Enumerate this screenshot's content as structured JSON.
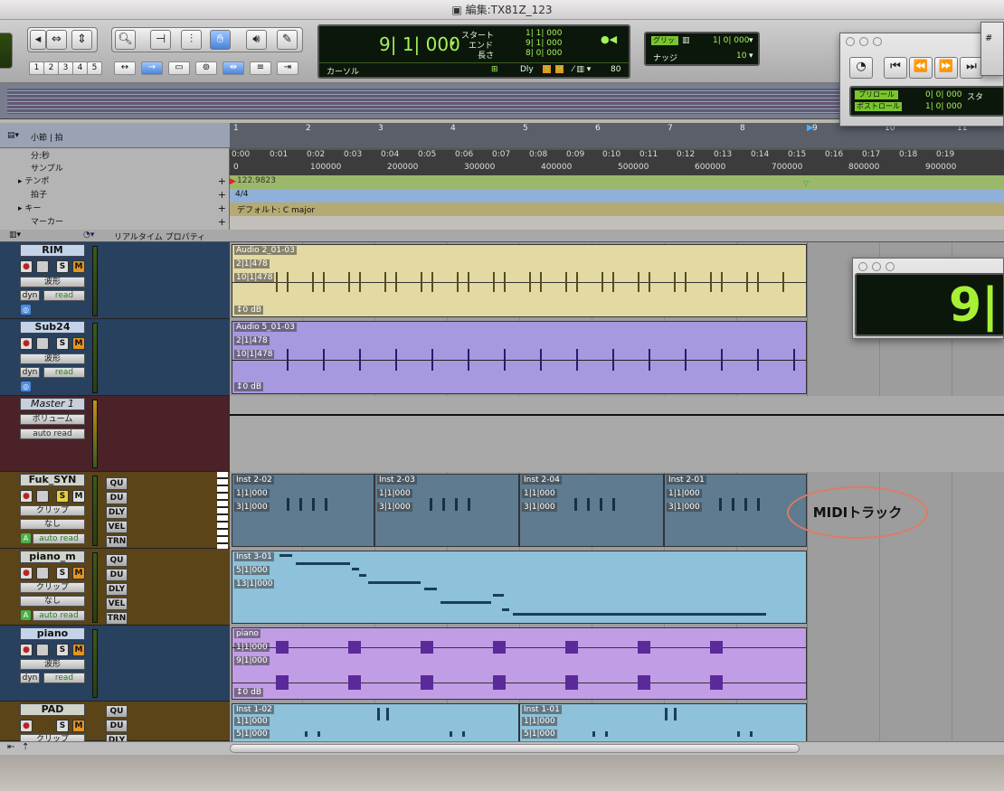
{
  "window": {
    "title": "編集:TX81Z_123"
  },
  "toolbar": {
    "zoom_presets": [
      "1",
      "2",
      "3",
      "4",
      "5"
    ],
    "counter": {
      "main": "9| 1| 000",
      "start_label": "スタート",
      "end_label": "エンド",
      "length_label": "長さ",
      "start": "1| 1| 000",
      "end": "9| 1| 000",
      "length": "8| 0| 000",
      "cursor_label": "カーソル",
      "dly_label": "Dly",
      "tempo": "80"
    },
    "grid": {
      "label": "グリッド",
      "value": "1| 0| 000",
      "nudge_label": "ナッジ",
      "nudge_value": "10"
    }
  },
  "transport": {
    "preroll_label": "プリロール",
    "preroll": "0| 0| 000",
    "postroll_label": "ポストロール",
    "postroll": "1| 0| 000",
    "partial_label": "スタ",
    "extra": "#"
  },
  "big_counter": {
    "value": "9|"
  },
  "rulers": {
    "bar_beat_label": "小節 | 拍",
    "minsec_label": "分:秒",
    "samples_label": "サンプル",
    "tempo_label": "テンポ",
    "meter_label": "拍子",
    "key_label": "キー",
    "marker_label": "マーカー",
    "bars": [
      "1",
      "2",
      "3",
      "4",
      "5",
      "6",
      "7",
      "8",
      "9",
      "10",
      "11"
    ],
    "minsec": [
      "0:00",
      "0:01",
      "0:02",
      "0:03",
      "0:04",
      "0:05",
      "0:06",
      "0:07",
      "0:08",
      "0:09",
      "0:10",
      "0:11",
      "0:12",
      "0:13",
      "0:14",
      "0:15",
      "0:16",
      "0:17",
      "0:18",
      "0:19"
    ],
    "samples": [
      "0",
      "100000",
      "200000",
      "300000",
      "400000",
      "500000",
      "600000",
      "700000",
      "800000",
      "900000"
    ],
    "tempo_value": "122.9823",
    "meter_value": "4/4",
    "key_value": "デフォルト: C major"
  },
  "header": {
    "realtime_label": "リアルタイム プロパティ"
  },
  "tracks": [
    {
      "name": "RIM",
      "view": "波形",
      "auto": "dyn",
      "auto_mode": "read"
    },
    {
      "name": "Sub24",
      "view": "波形",
      "auto": "dyn",
      "auto_mode": "read"
    },
    {
      "name": "Master 1",
      "view": "ボリューム",
      "auto_mode": "auto read"
    },
    {
      "name": "Fuk_SYN",
      "view": "クリップ",
      "none": "なし",
      "auto_mode": "auto read",
      "qu": "QU",
      "du": "DU",
      "dly": "DLY",
      "vel": "VEL",
      "trn": "TRN"
    },
    {
      "name": "piano_m",
      "view": "クリップ",
      "none": "なし",
      "auto_mode": "auto read",
      "qu": "QU",
      "du": "DU",
      "dly": "DLY",
      "vel": "VEL",
      "trn": "TRN"
    },
    {
      "name": "piano",
      "view": "波形",
      "auto": "dyn",
      "auto_mode": "read"
    },
    {
      "name": "PAD",
      "view": "クリップ",
      "qu": "QU",
      "du": "DU",
      "dly": "DLY"
    }
  ],
  "regions": {
    "rim": {
      "name": "Audio 2_01-03",
      "i1": "2|1|478",
      "i2": "10|1|478",
      "gain": "0 dB"
    },
    "sub": {
      "name": "Audio 5_01-03",
      "i1": "2|1|478",
      "i2": "10|1|478",
      "gain": "0 dB"
    },
    "fuk": [
      {
        "name": "Inst 2-02",
        "i1": "1|1|000",
        "i2": "3|1|000"
      },
      {
        "name": "Inst 2-03",
        "i1": "1|1|000",
        "i2": "3|1|000"
      },
      {
        "name": "Inst 2-04",
        "i1": "1|1|000",
        "i2": "3|1|000"
      },
      {
        "name": "Inst 2-01",
        "i1": "1|1|000",
        "i2": "3|1|000"
      }
    ],
    "piano_m": {
      "name": "Inst 3-01",
      "i1": "5|1|000",
      "i2": "13|1|000"
    },
    "piano": {
      "name": "piano",
      "i1": "1|1|000",
      "i2": "9|1|000",
      "gain": "0 dB"
    },
    "pad": [
      {
        "name": "Inst 1-02",
        "i1": "1|1|000",
        "i2": "5|1|000"
      },
      {
        "name": "Inst 1-01",
        "i1": "1|1|000",
        "i2": "5|1|000"
      }
    ],
    "ruler_num_2": "2",
    "ruler_num_4": "4",
    "ruler_num_5": "5"
  },
  "annotation": {
    "label": "MIDIトラック"
  }
}
